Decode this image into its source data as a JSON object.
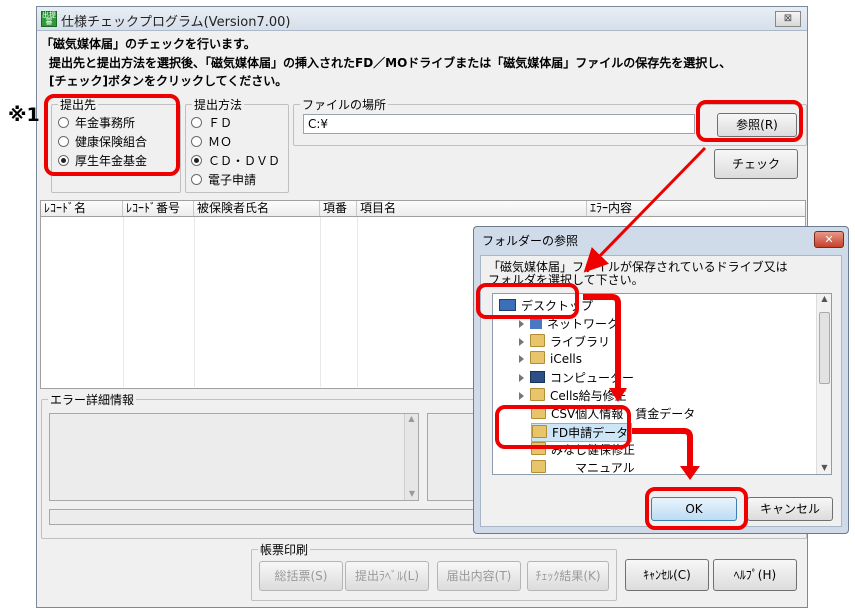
{
  "window": {
    "title": "仕様チェックプログラム(Version7.00)",
    "icon_text": "出提審",
    "close_glyph": "⊠"
  },
  "instructions": [
    "「磁気媒体届」のチェックを行います。",
    "提出先と提出方法を選択後、「磁気媒体届」の挿入されたFD／MOドライブまたは「磁気媒体届」ファイルの保存先を選択し、",
    "[チェック]ボタンをクリックしてください。"
  ],
  "annotation": "※1",
  "destination": {
    "label": "提出先",
    "options": [
      "年金事務所",
      "健康保険組合",
      "厚生年金基金"
    ],
    "selected": 2
  },
  "method": {
    "label": "提出方法",
    "options": [
      "ＦＤ",
      "ＭＯ",
      "ＣＤ・ＤＶＤ",
      "電子申請"
    ],
    "selected": 2
  },
  "file_location": {
    "label": "ファイルの場所",
    "value": "C:¥",
    "browse_label": "参照(R)",
    "check_label": "チェック"
  },
  "list": {
    "columns": [
      "ﾚｺｰﾄﾞ名",
      "ﾚｺｰﾄﾞ番号",
      "被保険者氏名",
      "項番",
      "項目名",
      "ｴﾗｰ内容"
    ]
  },
  "error_detail": {
    "label": "エラー詳細情報"
  },
  "report_print": {
    "label": "帳票印刷",
    "buttons": [
      "総括票(S)",
      "提出ﾗﾍﾞﾙ(L)",
      "届出内容(T)",
      "ﾁｪｯｸ結果(K)"
    ]
  },
  "footer_buttons": {
    "cancel": "ｷｬﾝｾﾙ(C)",
    "help": "ﾍﾙﾌﾟ(H)"
  },
  "dialog": {
    "title": "フォルダーの参照",
    "close_glyph": "✕",
    "message": "「磁気媒体届」ファイルが保存されているドライブ又は\nフォルダを選択して下さい。",
    "tree": [
      "デスクトップ",
      "ネットワーク",
      "ライブラリ",
      "iCells",
      "コンピューター",
      "Cells給与修正",
      "CSV個人情報・賃金データ",
      "FD申請データ",
      "みなし健保修正",
      "マニュアル"
    ],
    "selected": "FD申請データ",
    "ok_label": "OK",
    "cancel_label": "キャンセル"
  },
  "colors": {
    "highlight": "#ee0000",
    "radio_on": "#222222"
  }
}
